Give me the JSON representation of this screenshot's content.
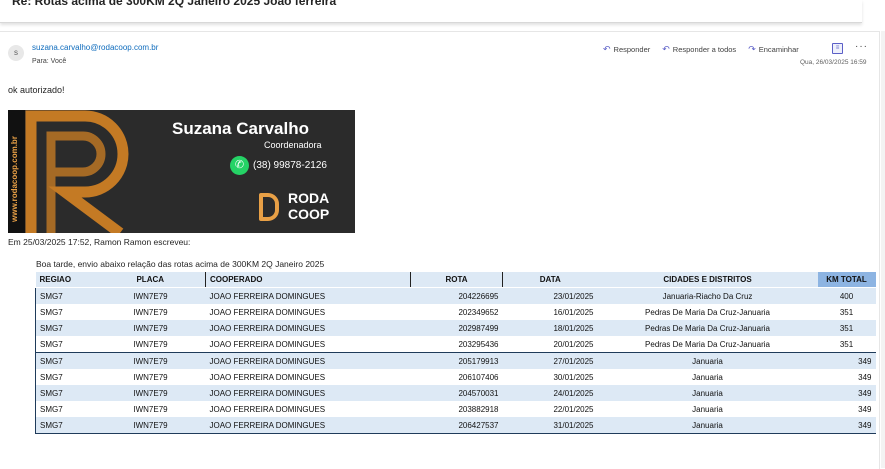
{
  "subject": "Re: Rotas acima de 300KM 2Q Janeiro 2025 Joao ferreira",
  "message": {
    "avatar_initial": "s",
    "from": "suzana.carvalho@rodacoop.com.br",
    "to": "Para:  Você",
    "date": "Qua, 26/03/2025 16:59",
    "actions": {
      "reply": "Responder",
      "reply_all": "Responder a todos",
      "forward": "Encaminhar"
    },
    "body": "ok autorizado!"
  },
  "signature": {
    "website": "www.rodacoop.com.br",
    "name": "Suzana Carvalho",
    "role": "Coordenadora",
    "phone": "(38) 99878-2126",
    "brand_line1": "RODA",
    "brand_line2": "COOP"
  },
  "quote": {
    "header": "Em 25/03/2025 17:52, Ramon Ramon escreveu:",
    "intro": "Boa tarde, envio abaixo relação das rotas acima de  300KM 2Q Janeiro 2025"
  },
  "table": {
    "headers": [
      "REGIAO",
      "PLACA",
      "COOPERADO",
      "ROTA",
      "DATA",
      "CIDADES E DISTRITOS",
      "KM TOTAL"
    ],
    "rows": [
      [
        "SMG7",
        "IWN7E79",
        "JOAO FERREIRA DOMINGUES",
        "204226695",
        "23/01/2025",
        "Januaria-Riacho Da Cruz",
        "400"
      ],
      [
        "SMG7",
        "IWN7E79",
        "JOAO FERREIRA DOMINGUES",
        "202349652",
        "16/01/2025",
        "Pedras De Maria Da Cruz-Januaria",
        "351"
      ],
      [
        "SMG7",
        "IWN7E79",
        "JOAO FERREIRA DOMINGUES",
        "202987499",
        "18/01/2025",
        "Pedras De Maria Da Cruz-Januaria",
        "351"
      ],
      [
        "SMG7",
        "IWN7E79",
        "JOAO FERREIRA DOMINGUES",
        "203295436",
        "20/01/2025",
        "Pedras De Maria Da Cruz-Januaria",
        "351"
      ],
      [
        "SMG7",
        "IWN7E79",
        "JOAO FERREIRA DOMINGUES",
        "205179913",
        "27/01/2025",
        "Januaria",
        "349"
      ],
      [
        "SMG7",
        "IWN7E79",
        "JOAO FERREIRA DOMINGUES",
        "206107406",
        "30/01/2025",
        "Januaria",
        "349"
      ],
      [
        "SMG7",
        "IWN7E79",
        "JOAO FERREIRA DOMINGUES",
        "204570031",
        "24/01/2025",
        "Januaria",
        "349"
      ],
      [
        "SMG7",
        "IWN7E79",
        "JOAO FERREIRA DOMINGUES",
        "203882918",
        "22/01/2025",
        "Januaria",
        "349"
      ],
      [
        "SMG7",
        "IWN7E79",
        "JOAO FERREIRA DOMINGUES",
        "206427537",
        "31/01/2025",
        "Januaria",
        "349"
      ]
    ]
  },
  "colors": {
    "brand_orange": "#e8a046",
    "link_blue": "#0f6cbd",
    "action_purple": "#5b5fc7",
    "row_band": "#dde9f5",
    "km_header": "#8db4e2"
  },
  "icons": {
    "reply": "reply-icon",
    "reply_all": "reply-all-icon",
    "forward": "forward-icon",
    "immersive_reader": "immersive-reader-icon",
    "more": "more-options-icon",
    "whatsapp": "whatsapp-icon"
  }
}
